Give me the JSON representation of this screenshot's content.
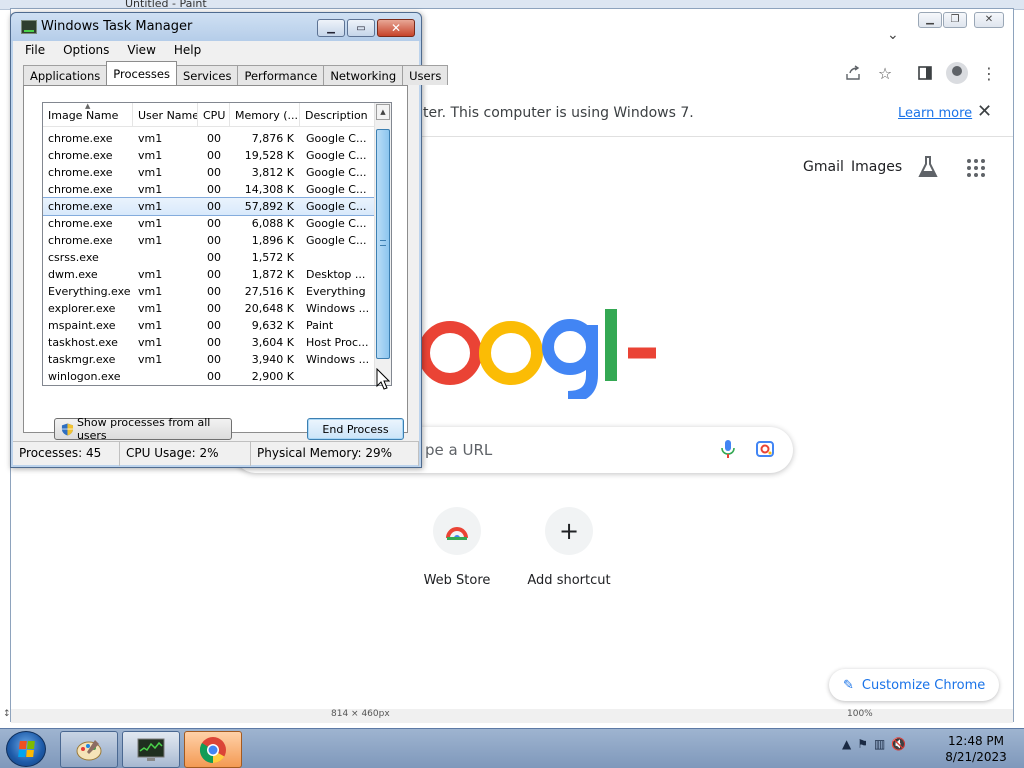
{
  "paint": {
    "title": "Untitled - Paint"
  },
  "chrome": {
    "tab_chevron": "⌄",
    "infobar": {
      "text": "ter. This computer is using Windows 7.",
      "learn_more": "Learn more",
      "close": "✕"
    },
    "header_links": {
      "gmail": "Gmail",
      "images": "Images"
    },
    "search_placeholder": "pe a URL",
    "shortcuts": [
      {
        "label": "Web Store"
      },
      {
        "label": "Add shortcut",
        "glyph": "+"
      }
    ],
    "customize_label": "Customize Chrome",
    "status_left": "↕",
    "status_mid": "814 × 460px",
    "status_right": "100%"
  },
  "task_manager": {
    "title": "Windows Task Manager",
    "menu": [
      "File",
      "Options",
      "View",
      "Help"
    ],
    "tabs": [
      "Applications",
      "Processes",
      "Services",
      "Performance",
      "Networking",
      "Users"
    ],
    "active_tab": "Processes",
    "columns": [
      "Image Name",
      "User Name",
      "CPU",
      "Memory (...",
      "Description"
    ],
    "rows": [
      {
        "name": "chrome.exe",
        "user": "vm1",
        "cpu": "00",
        "mem": "7,876 K",
        "desc": "Google C..."
      },
      {
        "name": "chrome.exe",
        "user": "vm1",
        "cpu": "00",
        "mem": "19,528 K",
        "desc": "Google C..."
      },
      {
        "name": "chrome.exe",
        "user": "vm1",
        "cpu": "00",
        "mem": "3,812 K",
        "desc": "Google C..."
      },
      {
        "name": "chrome.exe",
        "user": "vm1",
        "cpu": "00",
        "mem": "14,308 K",
        "desc": "Google C..."
      },
      {
        "name": "chrome.exe",
        "user": "vm1",
        "cpu": "00",
        "mem": "57,892 K",
        "desc": "Google C..."
      },
      {
        "name": "chrome.exe",
        "user": "vm1",
        "cpu": "00",
        "mem": "6,088 K",
        "desc": "Google C..."
      },
      {
        "name": "chrome.exe",
        "user": "vm1",
        "cpu": "00",
        "mem": "1,896 K",
        "desc": "Google C..."
      },
      {
        "name": "csrss.exe",
        "user": "",
        "cpu": "00",
        "mem": "1,572 K",
        "desc": ""
      },
      {
        "name": "dwm.exe",
        "user": "vm1",
        "cpu": "00",
        "mem": "1,872 K",
        "desc": "Desktop ..."
      },
      {
        "name": "Everything.exe",
        "user": "vm1",
        "cpu": "00",
        "mem": "27,516 K",
        "desc": "Everything"
      },
      {
        "name": "explorer.exe",
        "user": "vm1",
        "cpu": "00",
        "mem": "20,648 K",
        "desc": "Windows ..."
      },
      {
        "name": "mspaint.exe",
        "user": "vm1",
        "cpu": "00",
        "mem": "9,632 K",
        "desc": "Paint"
      },
      {
        "name": "taskhost.exe",
        "user": "vm1",
        "cpu": "00",
        "mem": "3,604 K",
        "desc": "Host Proc..."
      },
      {
        "name": "taskmgr.exe",
        "user": "vm1",
        "cpu": "00",
        "mem": "3,940 K",
        "desc": "Windows ..."
      },
      {
        "name": "winlogon.exe",
        "user": "",
        "cpu": "00",
        "mem": "2,900 K",
        "desc": ""
      }
    ],
    "selected_row": 4,
    "show_all_label": "Show processes from all users",
    "end_process_label": "End Process",
    "status": {
      "processes": "Processes: 45",
      "cpu": "CPU Usage: 2%",
      "memory": "Physical Memory: 29%"
    }
  },
  "taskbar": {
    "clock_time": "12:48 PM",
    "clock_date": "8/21/2023"
  },
  "colors": {
    "google_blue": "#4285f4",
    "google_red": "#ea4335",
    "google_yellow": "#fbbc05",
    "google_green": "#34a853",
    "chrome_accent": "#1a73e8",
    "selection": "#d8e9fb"
  }
}
